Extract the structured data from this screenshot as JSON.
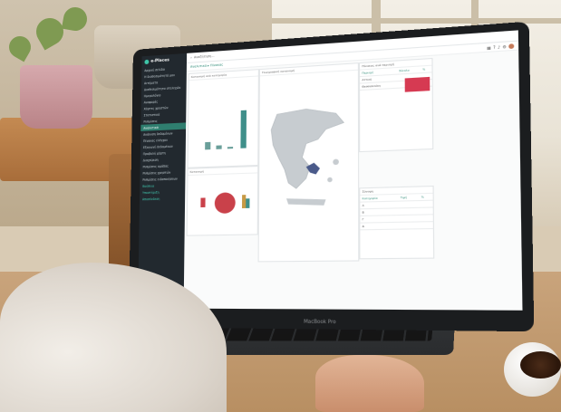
{
  "app": {
    "brand": "e-Places",
    "search_placeholder": "Αναζήτηση..."
  },
  "sidebar": {
    "items": [
      {
        "label": "Αρχική σελίδα"
      },
      {
        "label": "Η διαθεσιμότητά μου"
      },
      {
        "label": "Αιτήματα"
      },
      {
        "label": "Διαθεσιμότητα στελεχών"
      },
      {
        "label": "Ημερολόγιο"
      },
      {
        "label": "Αναφορές"
      },
      {
        "label": "Χάρτες χρηστών"
      },
      {
        "label": "Στατιστικά"
      },
      {
        "label": "Ρυθμίσεις"
      },
      {
        "label": "Αναλυτικά",
        "active": true
      },
      {
        "label": "Ανάλυση δεδομένων"
      },
      {
        "label": "Πίνακας ελέγχου"
      },
      {
        "label": "Εξαγωγή δεδομένων"
      },
      {
        "label": "Προβολή χάρτη"
      },
      {
        "label": "Διαχείριση"
      },
      {
        "label": "Ρυθμίσεις ομάδας"
      },
      {
        "label": "Ρυθμίσεις χρηστών"
      },
      {
        "label": "Ρυθμίσεις ειδοποιήσεων"
      },
      {
        "label": "Βοήθεια",
        "teal": true
      },
      {
        "label": "Υποστήριξη",
        "teal": true
      },
      {
        "label": "Αποσύνδεση",
        "teal": true
      }
    ]
  },
  "breadcrumb": "Αναλυτικά ▸ Πίνακας",
  "panels": {
    "bar_title": "Κατανομή ανά κατηγορία",
    "map_title": "Γεωγραφική κατανομή",
    "table_title": "Πίνακας ανά περιοχή",
    "pie_title": "Κατανομή",
    "table2_title": "Σύνοψη"
  },
  "table": {
    "headers": [
      "Περιοχή",
      "Σύνολο",
      "%"
    ],
    "rows": [
      [
        "Αττική",
        "",
        ""
      ],
      [
        "Θεσσαλονίκη",
        "",
        ""
      ]
    ]
  },
  "table2": {
    "headers": [
      "Κατηγορία",
      "Τιμή",
      "%"
    ],
    "rows": [
      [
        "Α",
        "",
        ""
      ],
      [
        "Β",
        "",
        ""
      ],
      [
        "Γ",
        "",
        ""
      ],
      [
        "Δ",
        "",
        ""
      ]
    ]
  },
  "device_brand": "MacBook Pro",
  "colors": {
    "accent": "#2e8c78",
    "bar_teal": "#3f8f8a",
    "pie_red": "#c9414a",
    "sidebar_bg": "#22292f"
  }
}
